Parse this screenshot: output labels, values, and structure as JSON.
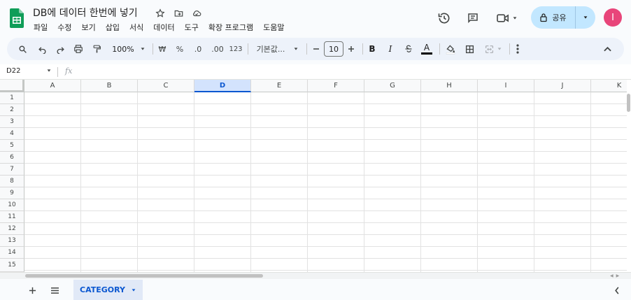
{
  "header": {
    "title": "DB에 데이터 한번에 넣기",
    "menu": [
      "파일",
      "수정",
      "보기",
      "삽입",
      "서식",
      "데이터",
      "도구",
      "확장 프로그램",
      "도움말"
    ],
    "share_label": "공유",
    "avatar_letter": "I"
  },
  "toolbar": {
    "zoom": "100%",
    "currency": "₩",
    "percent": "%",
    "dec_decrease": ".0",
    "dec_increase": ".00",
    "number_format": "123",
    "font_name": "기본값...",
    "font_size": "10",
    "bold": "B",
    "italic": "I",
    "text_color_label": "A"
  },
  "formula_bar": {
    "name_box": "D22",
    "fx": "fx",
    "value": ""
  },
  "grid": {
    "columns": [
      "A",
      "B",
      "C",
      "D",
      "E",
      "F",
      "G",
      "H",
      "I",
      "J",
      "K"
    ],
    "active_column": "D",
    "rows": [
      "1",
      "2",
      "3",
      "4",
      "5",
      "6",
      "7",
      "8",
      "9",
      "10",
      "11",
      "12",
      "13",
      "14",
      "15"
    ]
  },
  "sheets": {
    "tabs": [
      {
        "label": "CATEGORY",
        "active": true
      }
    ]
  },
  "colors": {
    "accent": "#0b57d0",
    "share_bg": "#c2e7ff",
    "avatar": "#e8457a",
    "sheets_green": "#0f9d58",
    "toolbar_bg": "#edf2fa"
  }
}
